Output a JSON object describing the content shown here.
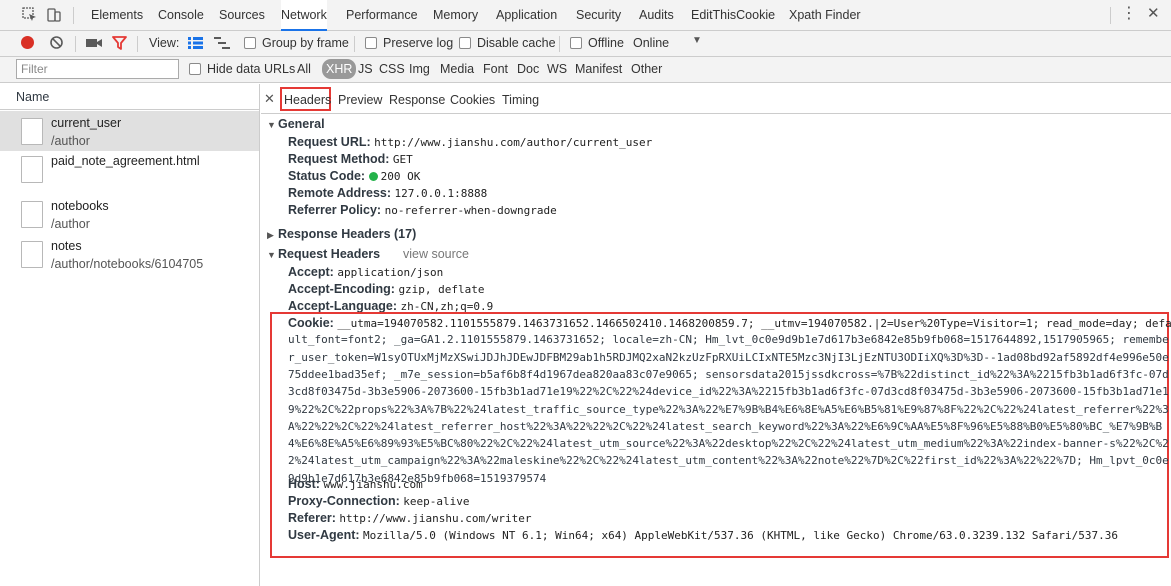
{
  "main_tabs": [
    {
      "label": "Elements"
    },
    {
      "label": "Console"
    },
    {
      "label": "Sources"
    },
    {
      "label": "Network"
    },
    {
      "label": "Performance"
    },
    {
      "label": "Memory"
    },
    {
      "label": "Application"
    },
    {
      "label": "Security"
    },
    {
      "label": "Audits"
    },
    {
      "label": "EditThisCookie"
    },
    {
      "label": "Xpath Finder"
    }
  ],
  "active_main_tab": "Network",
  "toolbar": {
    "view_label": "View:",
    "group_by_frame": "Group by frame",
    "preserve_log": "Preserve log",
    "disable_cache": "Disable cache",
    "offline": "Offline",
    "throttle": "Online"
  },
  "filter": {
    "placeholder": "Filter",
    "hide_data_urls": "Hide data URLs",
    "types": [
      "All",
      "XHR",
      "JS",
      "CSS",
      "Img",
      "Media",
      "Font",
      "Doc",
      "WS",
      "Manifest",
      "Other"
    ],
    "active_type": "XHR"
  },
  "list": {
    "header": "Name",
    "requests": [
      {
        "name": "current_user",
        "path": "/author",
        "selected": true
      },
      {
        "name": "paid_note_agreement.html",
        "path": ""
      },
      {
        "name": "notebooks",
        "path": "/author"
      },
      {
        "name": "notes",
        "path": "/author/notebooks/6104705"
      }
    ]
  },
  "detail_tabs": [
    "Headers",
    "Preview",
    "Response",
    "Cookies",
    "Timing"
  ],
  "active_detail_tab": "Headers",
  "general": {
    "title": "General",
    "rows": [
      {
        "key": "Request URL:",
        "value": "http://www.jianshu.com/author/current_user"
      },
      {
        "key": "Request Method:",
        "value": "GET"
      },
      {
        "key": "Status Code:",
        "value": "200 OK"
      },
      {
        "key": "Remote Address:",
        "value": "127.0.0.1:8888"
      },
      {
        "key": "Referrer Policy:",
        "value": "no-referrer-when-downgrade"
      }
    ]
  },
  "response_headers": {
    "title": "Response Headers (17)"
  },
  "request_headers": {
    "title": "Request Headers",
    "view_source": "view source",
    "rows_before": [
      {
        "key": "Accept:",
        "value": "application/json"
      },
      {
        "key": "Accept-Encoding:",
        "value": "gzip, deflate"
      },
      {
        "key": "Accept-Language:",
        "value": "zh-CN,zh;q=0.9"
      }
    ],
    "cookie_key": "Cookie:",
    "cookie_lines": [
      "__utma=194070582.1101555879.1463731652.1466502410.1468200859.7; __utmv=194070582.|2=User%20Type=Visitor=1; read_mode=day; defa",
      "ult_font=font2; _ga=GA1.2.1101555879.1463731652; locale=zh-CN; Hm_lvt_0c0e9d9b1e7d617b3e6842e85b9fb068=1517644892,1517905965; remembe",
      "r_user_token=W1syOTUxMjMzXSwiJDJhJDEwJDFBM29ab1h5RDJMQ2xaN2kzUzFpRXUiLCIxNTE5Mzc3NjI3LjEzNTU3ODIiXQ%3D%3D--1ad08bd92af5892df4e996e50e",
      "75ddee1bad35ef; _m7e_session=b5af6b8f4d1967dea820aa83c07e9065; sensorsdata2015jssdkcross=%7B%22distinct_id%22%3A%2215fb3b1ad6f3fc-07d",
      "3cd8f03475d-3b3e5906-2073600-15fb3b1ad71e19%22%2C%22%24device_id%22%3A%2215fb3b1ad6f3fc-07d3cd8f03475d-3b3e5906-2073600-15fb3b1ad71e1",
      "9%22%2C%22props%22%3A%7B%22%24latest_traffic_source_type%22%3A%22%E7%9B%B4%E6%8E%A5%E6%B5%81%E9%87%8F%22%2C%22%24latest_referrer%22%3",
      "A%22%22%2C%22%24latest_referrer_host%22%3A%22%22%2C%22%24latest_search_keyword%22%3A%22%E6%9C%AA%E5%8F%96%E5%88%B0%E5%80%BC_%E7%9B%B",
      "4%E6%8E%A5%E6%89%93%E5%BC%80%22%2C%22%24latest_utm_source%22%3A%22desktop%22%2C%22%24latest_utm_medium%22%3A%22index-banner-s%22%2C%2",
      "2%24latest_utm_campaign%22%3A%22maleskine%22%2C%22%24latest_utm_content%22%3A%22note%22%7D%2C%22first_id%22%3A%22%22%7D; Hm_lpvt_0c0e",
      "9d9b1e7d617b3e6842e85b9fb068=1519379574"
    ],
    "rows_after": [
      {
        "key": "Host:",
        "value": "www.jianshu.com"
      },
      {
        "key": "Proxy-Connection:",
        "value": "keep-alive"
      },
      {
        "key": "Referer:",
        "value": "http://www.jianshu.com/writer"
      },
      {
        "key": "User-Agent:",
        "value": "Mozilla/5.0 (Windows NT 6.1; Win64; x64) AppleWebKit/537.36 (KHTML, like Gecko) Chrome/63.0.3239.132 Safari/537.36"
      }
    ]
  },
  "colors": {
    "record": "#d93025",
    "filter_active": "#e53935",
    "highlight_box": "#e53935",
    "status_ok": "#24b24a",
    "active_tab_underline": "#1a73e8"
  },
  "icons": [
    "inspect-element-icon",
    "device-toolbar-icon",
    "record-icon",
    "clear-icon",
    "capture-screenshots-icon",
    "filter-icon",
    "large-rows-icon",
    "overview-icon",
    "throttle-dropdown-icon",
    "more-menu-icon",
    "close-devtools-icon",
    "close-details-icon",
    "expand-triangle-icon"
  ]
}
